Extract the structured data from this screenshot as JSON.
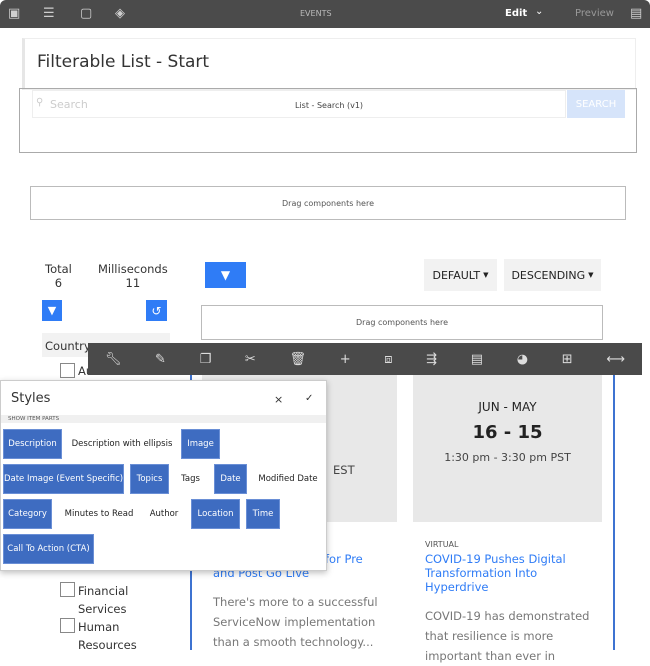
{
  "topbar": {
    "title": "EVENTS",
    "edit": "Edit",
    "preview": "Preview",
    "icons": [
      "side-panel-icon",
      "properties-icon",
      "emulator-icon",
      "layers-icon",
      "page-info-icon"
    ]
  },
  "page": {
    "title": "Filterable List - Start"
  },
  "search": {
    "placeholder": "Search",
    "component_label": "List - Search (v1)",
    "button": "SEARCH"
  },
  "drag_label": "Drag components here",
  "stats": {
    "total_label": "Total",
    "total": "6",
    "ms_label": "Milliseconds",
    "ms": "11"
  },
  "sort": {
    "default": "DEFAULT",
    "order": "DESCENDING"
  },
  "filters": {
    "country_label": "Country",
    "items": [
      "Australia",
      "Financial",
      "Services",
      "Human",
      "Resources"
    ]
  },
  "toolbar": {
    "icons": [
      "wrench-icon",
      "brush-icon",
      "copy-icon",
      "cut-icon",
      "delete-icon",
      "add-icon",
      "group-icon",
      "parent-icon",
      "layout-icon",
      "style-icon",
      "container-icon",
      "resize-icon"
    ]
  },
  "styles_dialog": {
    "title": "Styles",
    "section": "SHOW ITEM PARTS",
    "options": [
      {
        "label": "Description",
        "on": true
      },
      {
        "label": "Description with ellipsis",
        "on": false
      },
      {
        "label": "Image",
        "on": true
      },
      {
        "label": "Date Image (Event Specific)",
        "on": true
      },
      {
        "label": "Topics",
        "on": true
      },
      {
        "label": "Tags",
        "on": false
      },
      {
        "label": "Date",
        "on": true
      },
      {
        "label": "Modified Date",
        "on": false
      },
      {
        "label": "Category",
        "on": true
      },
      {
        "label": "Minutes to Read",
        "on": false
      },
      {
        "label": "Author",
        "on": false
      },
      {
        "label": "Location",
        "on": true
      },
      {
        "label": "Time",
        "on": true
      },
      {
        "label": "Call To Action (CTA)",
        "on": true
      }
    ]
  },
  "cards": [
    {
      "time_partial": "EST",
      "title_line1": "for Pre",
      "title_line2": "and Post Go Live",
      "desc": [
        "There's more to a successful",
        "ServiceNow implementation",
        "than a smooth technology..."
      ]
    },
    {
      "months": "JUN - MAY",
      "days": "16 - 15",
      "time": "1:30 pm - 3:30 pm PST",
      "category": "VIRTUAL",
      "title": [
        "COVID-19 Pushes Digital",
        "Transformation Into",
        "Hyperdrive"
      ],
      "desc": [
        "COVID-19 has demonstrated",
        "that resilience is more",
        "important than ever in"
      ]
    }
  ],
  "colors": {
    "accent": "#2f7cf6",
    "chip": "#3e6cc1",
    "topbar": "#4b4b4b"
  }
}
